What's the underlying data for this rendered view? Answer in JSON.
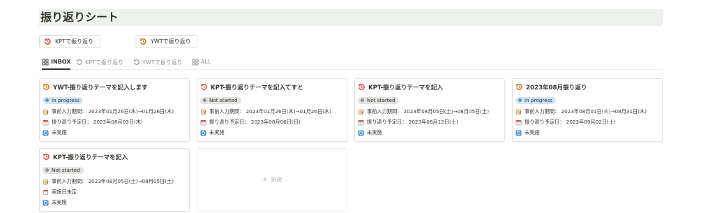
{
  "page": {
    "title": "振り返りシート"
  },
  "templates": [
    {
      "label": "KPTで振り返り",
      "icon": "undo-red-icon"
    },
    {
      "label": "YWTで振り返り",
      "icon": "undo-orange-icon"
    }
  ],
  "tabs": [
    {
      "label": "INBOX",
      "icon": "grid-icon",
      "active": true
    },
    {
      "label": "KPTで振り返り",
      "icon": "undo-gray-icon"
    },
    {
      "label": "YWTで振り返り",
      "icon": "undo-gray-icon"
    },
    {
      "label": "ALL",
      "icon": "grid-icon"
    }
  ],
  "cards": [
    {
      "title": "YWT-振り返りテーマを記入します",
      "icon": "undo-orange-icon",
      "status": "In progress",
      "period": "事前入力期間： 2023年01月26日(木)→01月26日(木)",
      "date_label": "振り返り予定日： 2023年08月03日(木)",
      "done": "未実施"
    },
    {
      "title": "KPT-振り返りテーマを記入てすと",
      "icon": "undo-red-icon",
      "status": "Not started",
      "period": "事前入力期間： 2023年01月26日(木)→01月26日(木)",
      "date_label": "振り返り予定日： 2023年08月06日(日)",
      "done": "未実施"
    },
    {
      "title": "KPT-振り返りテーマを記入",
      "icon": "undo-red-icon",
      "status": "Not started",
      "period": "事前入力期間： 2023年08月05日(土)→08月05日(土)",
      "date_label": "振り返り予定日： 2023年08月12日(土)",
      "done": "未実施"
    },
    {
      "title": "2023年08月振り返り",
      "icon": "undo-orange-icon",
      "status": "In progress",
      "period": "事前入力期間： 2023年08月01日(火)→08月31日(木)",
      "date_label": "振り返り予定日： 2023年09月02日(土)",
      "done": "未実施"
    },
    {
      "title": "KPT-振り返りテーマを記入",
      "icon": "undo-red-icon",
      "status": "Not started",
      "period": "事前入力期間： 2023年08月05日(土)→08月05日(土)",
      "date_label": "実施日未定",
      "done": "未実施"
    }
  ],
  "new_card": {
    "plus": "+",
    "label": "新規"
  },
  "colors": {
    "title_bg": "#edf3ec",
    "in_progress": "#d3e5ef",
    "not_started": "#e3e2e0",
    "kpt_red": "#d44c47",
    "ywt_orange": "#d9730d"
  }
}
